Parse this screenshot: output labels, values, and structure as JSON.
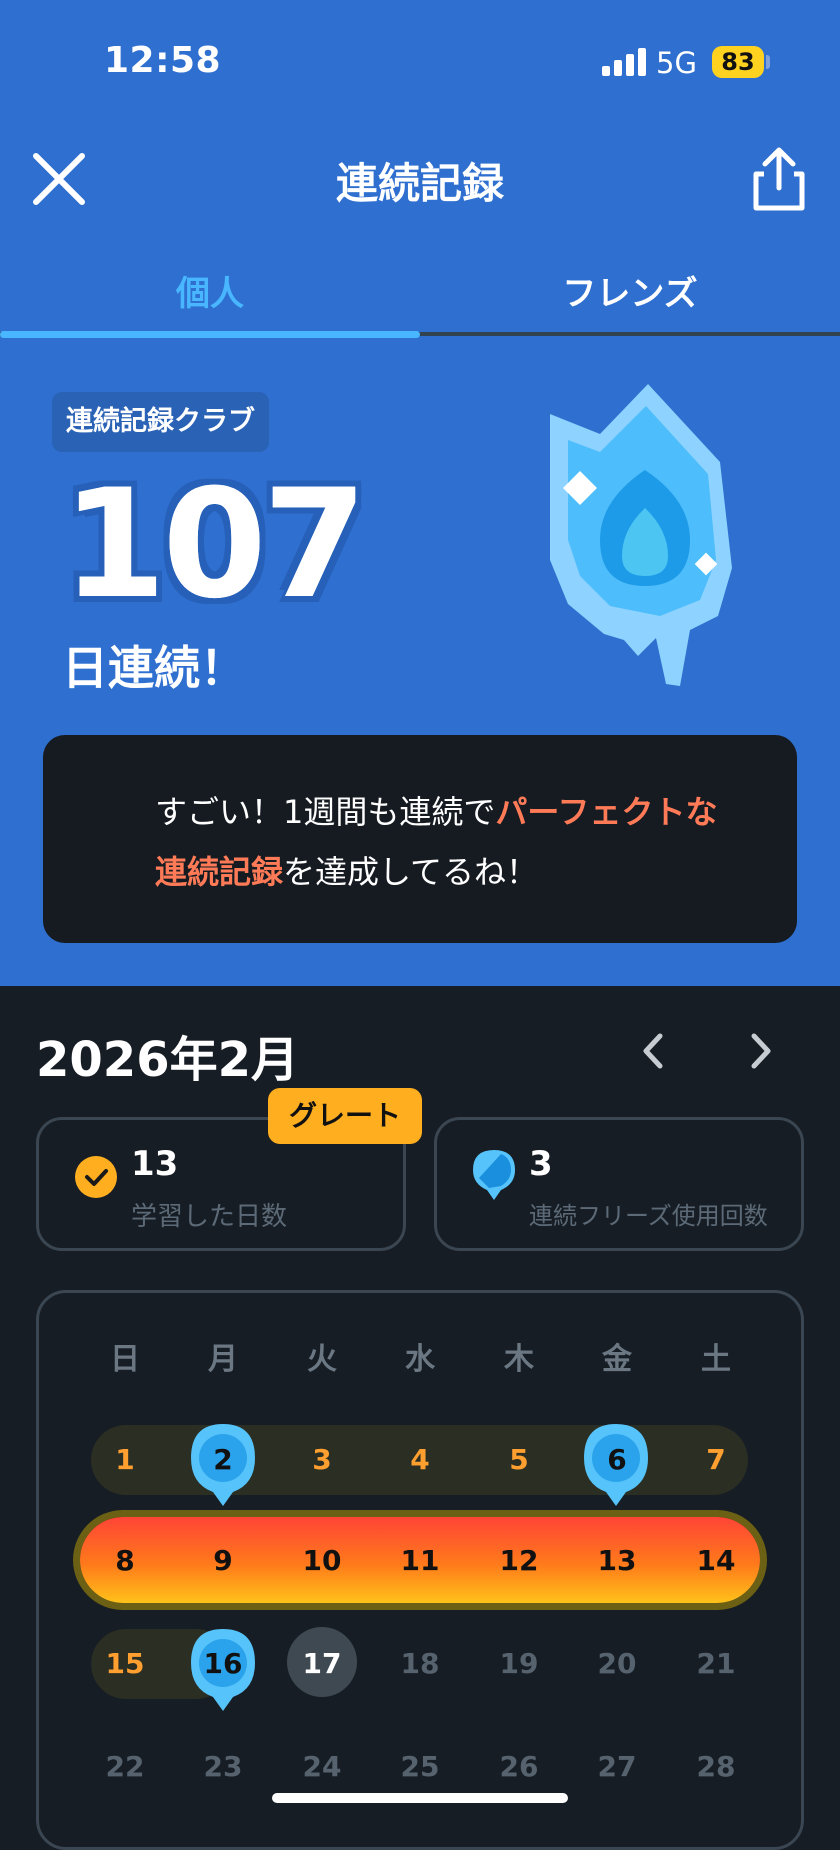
{
  "status": {
    "time": "12:58",
    "network": "5G",
    "battery": "83"
  },
  "header": {
    "title": "連続記録",
    "close_icon": "close-icon",
    "share_icon": "share-icon"
  },
  "tabs": [
    {
      "label": "個人"
    },
    {
      "label": "フレンズ"
    }
  ],
  "streak": {
    "club": "連続記録クラブ",
    "count": "107",
    "label": "日連続！"
  },
  "message": {
    "p1": "すごい！1週間も連続で",
    "h1": "パーフェクトな",
    "h2": "連続記録",
    "p2": "を達成してるね！"
  },
  "calendar": {
    "month": "2026年2月",
    "weekdays": [
      "日",
      "月",
      "火",
      "水",
      "木",
      "金",
      "土"
    ],
    "rows": [
      [
        "1",
        "2",
        "3",
        "4",
        "5",
        "6",
        "7"
      ],
      [
        "8",
        "9",
        "10",
        "11",
        "12",
        "13",
        "14"
      ],
      [
        "15",
        "16",
        "17",
        "18",
        "19",
        "20",
        "21"
      ],
      [
        "22",
        "23",
        "24",
        "25",
        "26",
        "27",
        "28"
      ]
    ]
  },
  "stats": {
    "badge": "グレート",
    "days_value": "13",
    "days_label": "学習した日数",
    "freeze_value": "3",
    "freeze_label": "連続フリーズ使用回数"
  },
  "colors": {
    "header_bg": "#2e6fd0",
    "accent_blue": "#49b7ff",
    "highlight": "#ff7b57",
    "badge": "#ffae1f",
    "dark_bg": "#171d24"
  }
}
